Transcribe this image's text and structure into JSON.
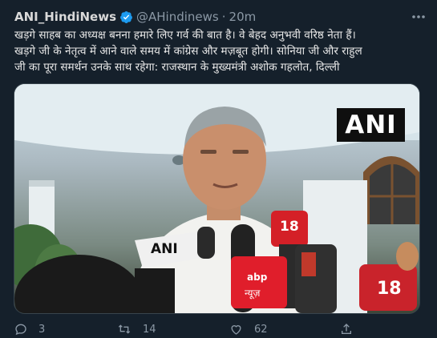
{
  "tweet": {
    "display_name": "ANI_HindiNews",
    "handle": "@AHindinews",
    "separator": "·",
    "time": "20m",
    "text_lines": [
      "खड़गे साहब का अध्यक्ष बनना हमारे लिए गर्व की बात है। वे बेहद अनुभवी वरिष्ठ नेता हैं।",
      "खड़गे जी के नेतृत्व में आने वाले समय में कांग्रेस और मज़बूत होगी। सोनिया जी और राहुल",
      "जी का पूरा समर्थन उनके साथ रहेगा: राजस्थान के मुख्यमंत्री अशोक गहलोत, दिल्ली"
    ],
    "media": {
      "watermark": "ANI",
      "mic_labels": [
        "ANI",
        "18",
        "abp",
        "न्यूज़",
        "18"
      ]
    },
    "metrics": {
      "replies": "3",
      "retweets": "14",
      "likes": "62"
    }
  },
  "colors": {
    "background": "#15202b",
    "verified": "#1d9bf0",
    "muted": "#8b98a5"
  }
}
